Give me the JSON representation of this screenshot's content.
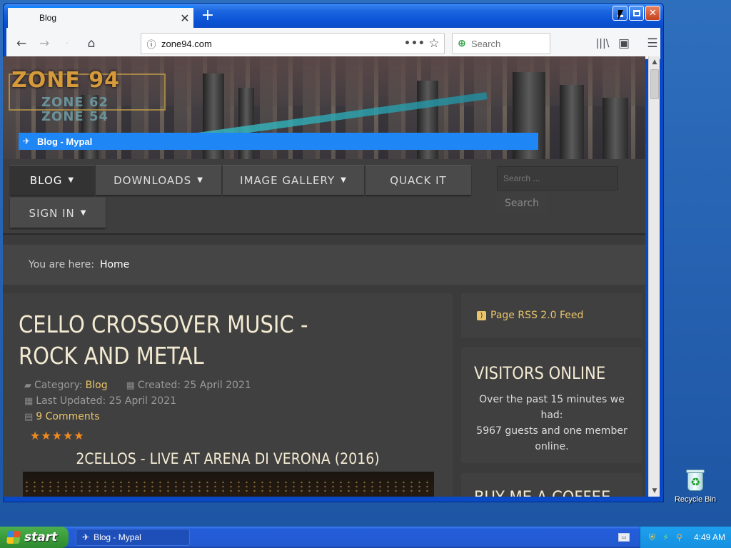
{
  "browser": {
    "tab_title": "Blog",
    "url": "zone94.com",
    "search_placeholder": "Search"
  },
  "page": {
    "logo": {
      "line1": "ZONE 94",
      "line2": "ZONE 62",
      "line3": "ZONE 54"
    },
    "blog_bar": "Blog - Mypal",
    "nav": {
      "items": [
        {
          "label": "BLOG",
          "has_caret": true,
          "active": true
        },
        {
          "label": "DOWNLOADS",
          "has_caret": true
        },
        {
          "label": "IMAGE GALLERY",
          "has_caret": true
        },
        {
          "label": "QUACK IT",
          "has_caret": false
        },
        {
          "label": "SIGN IN",
          "has_caret": true
        }
      ],
      "search_placeholder": "Search ...",
      "search_button": "Search"
    },
    "breadcrumb": {
      "prefix": "You are here:",
      "home": "Home"
    },
    "article": {
      "title": "CELLO CROSSOVER MUSIC - ROCK AND METAL",
      "category_label": "Category:",
      "category_value": "Blog",
      "created": "Created: 25 April 2021",
      "last_updated": "Last Updated: 25 April 2021",
      "comments": "9 Comments",
      "rating_stars": 5,
      "subtitle": "2CELLOS - LIVE AT ARENA DI VERONA (2016)"
    },
    "sidebar": {
      "rss_label": "Page RSS 2.0 Feed",
      "visitors_title": "VISITORS ONLINE",
      "visitors_line1": "Over the past 15 minutes we",
      "visitors_line2": "had:",
      "visitors_line3": "5967 guests and one member",
      "visitors_line4": "online.",
      "coffee_title": "BUY ME A COFFEE"
    }
  },
  "desktop": {
    "recycle_bin": "Recycle Bin"
  },
  "taskbar": {
    "start_label": "start",
    "task_item": "Blog - Mypal",
    "clock": "4:49 AM"
  },
  "colors": {
    "accent_link": "#e9c46a",
    "blog_bar": "#1e86f5",
    "rating": "#f08a1e"
  }
}
